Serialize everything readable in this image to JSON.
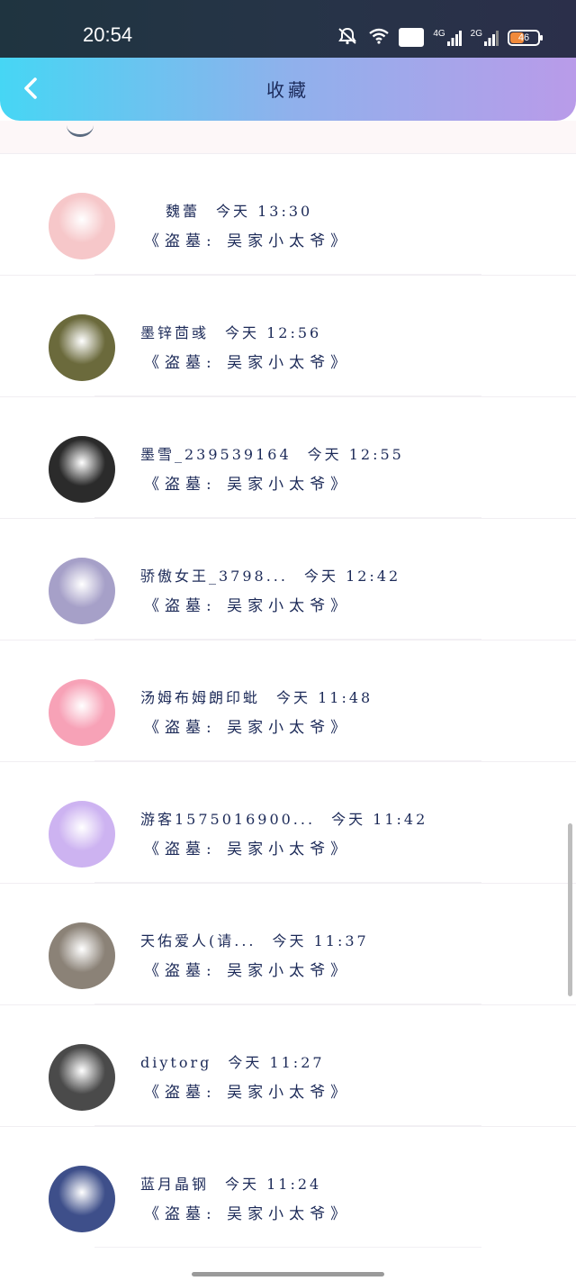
{
  "status_bar": {
    "time": "20:54",
    "hd_label": "HD",
    "signal1_label": "4G",
    "signal2_label": "2G",
    "battery_level": "46"
  },
  "header": {
    "title": "收藏"
  },
  "items": [
    {
      "name": "魏蕾",
      "time": "今天 13:30",
      "title": "《盗墓: 吴家小太爷》",
      "avatar_color": "#f6c7c9"
    },
    {
      "name": "墨锌茴彧",
      "time": "今天 12:56",
      "title": "《盗墓: 吴家小太爷》",
      "avatar_color": "#6b6a3c"
    },
    {
      "name": "墨雪_239539164",
      "time": "今天 12:55",
      "title": "《盗墓: 吴家小太爷》",
      "avatar_color": "#2b2b2b"
    },
    {
      "name": "骄傲女王_3798...",
      "time": "今天 12:42",
      "title": "《盗墓: 吴家小太爷》",
      "avatar_color": "#a6a0c8"
    },
    {
      "name": "汤姆布姆朗印蚍",
      "time": "今天 11:48",
      "title": "《盗墓: 吴家小太爷》",
      "avatar_color": "#f7a2b7"
    },
    {
      "name": "游客1575016900...",
      "time": "今天 11:42",
      "title": "《盗墓: 吴家小太爷》",
      "avatar_color": "#cdb3f1"
    },
    {
      "name": "天佑爱人(请...",
      "time": "今天 11:37",
      "title": "《盗墓: 吴家小太爷》",
      "avatar_color": "#8b8277"
    },
    {
      "name": "diytorg",
      "time": "今天 11:27",
      "title": "《盗墓: 吴家小太爷》",
      "avatar_color": "#4a4a4a"
    },
    {
      "name": "蓝月晶钢",
      "time": "今天 11:24",
      "title": "《盗墓: 吴家小太爷》",
      "avatar_color": "#3e4f8a"
    }
  ],
  "icons": {
    "back": "chevron-left-icon",
    "mute": "bell-off-icon",
    "wifi": "wifi-icon",
    "battery": "battery-icon"
  },
  "colors": {
    "header_start": "#46d6f4",
    "header_end": "#b99be9",
    "text": "#1c2a58"
  }
}
